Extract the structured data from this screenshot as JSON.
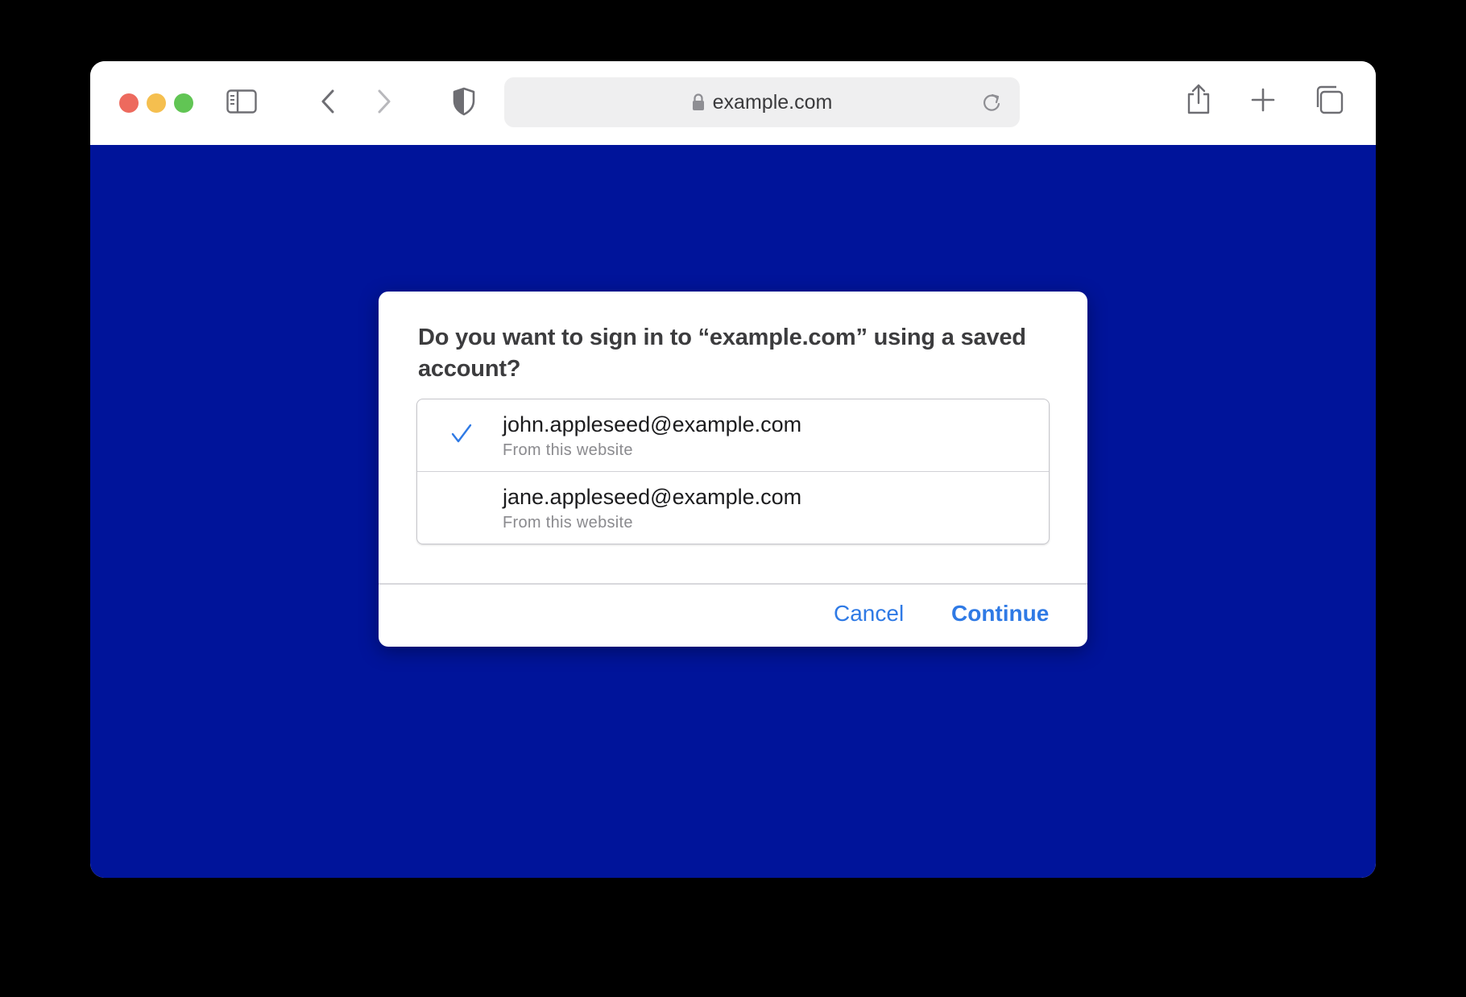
{
  "colors": {
    "page_background": "#00149a",
    "traffic_close": "#ed6a5e",
    "traffic_minimize": "#f5bf4f",
    "traffic_zoom": "#61c554",
    "accent": "#2f7ae5"
  },
  "toolbar": {
    "address": "example.com",
    "icons": [
      "sidebar-icon",
      "back-icon",
      "forward-icon",
      "privacy-shield-icon",
      "lock-icon",
      "reload-icon",
      "share-icon",
      "new-tab-icon",
      "tab-overview-icon"
    ]
  },
  "dialog": {
    "title": "Do you want to sign in to “example.com” using a saved account?",
    "accounts": [
      {
        "email": "john.appleseed@example.com",
        "source": "From this website",
        "selected": true
      },
      {
        "email": "jane.appleseed@example.com",
        "source": "From this website",
        "selected": false
      }
    ],
    "cancel_label": "Cancel",
    "continue_label": "Continue"
  }
}
